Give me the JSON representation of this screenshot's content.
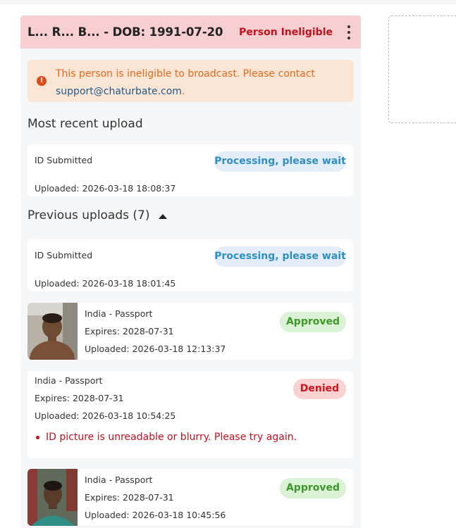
{
  "header": {
    "title": "L... R... B... - DOB: 1991-07-20",
    "status": "Person Ineligible"
  },
  "alert": {
    "icon": "exclamation-icon",
    "text": "This person is ineligible to broadcast. Please contact",
    "link": "support@chaturbate.com",
    "suffix": "."
  },
  "recent": {
    "title": "Most recent upload",
    "item": {
      "label": "ID Submitted",
      "status": "Processing, please wait",
      "uploaded": "Uploaded: 2026-03-18 18:08:37"
    }
  },
  "previous": {
    "title": "Previous uploads (7)",
    "items": [
      {
        "label": "ID Submitted",
        "status": "Processing, please wait",
        "uploaded": "Uploaded: 2026-03-18 18:01:45"
      },
      {
        "label": "India - Passport",
        "expires": "Expires: 2028-07-31",
        "uploaded": "Uploaded: 2026-03-18 12:13:37",
        "status": "Approved"
      },
      {
        "label": "India - Passport",
        "expires": "Expires: 2028-07-31",
        "uploaded": "Uploaded: 2026-03-18 10:54:25",
        "status": "Denied",
        "reason": "ID picture is unreadable or blurry. Please try again."
      },
      {
        "label": "India - Passport",
        "expires": "Expires: 2028-07-31",
        "uploaded": "Uploaded: 2026-03-18 10:45:56",
        "status": "Approved"
      }
    ]
  },
  "colors": {
    "header_bg": "#f7cfd1",
    "ineligible": "#c0111f",
    "processing": "#2f8fc4",
    "approved": "#3b9a2a",
    "denied": "#d3141e"
  }
}
